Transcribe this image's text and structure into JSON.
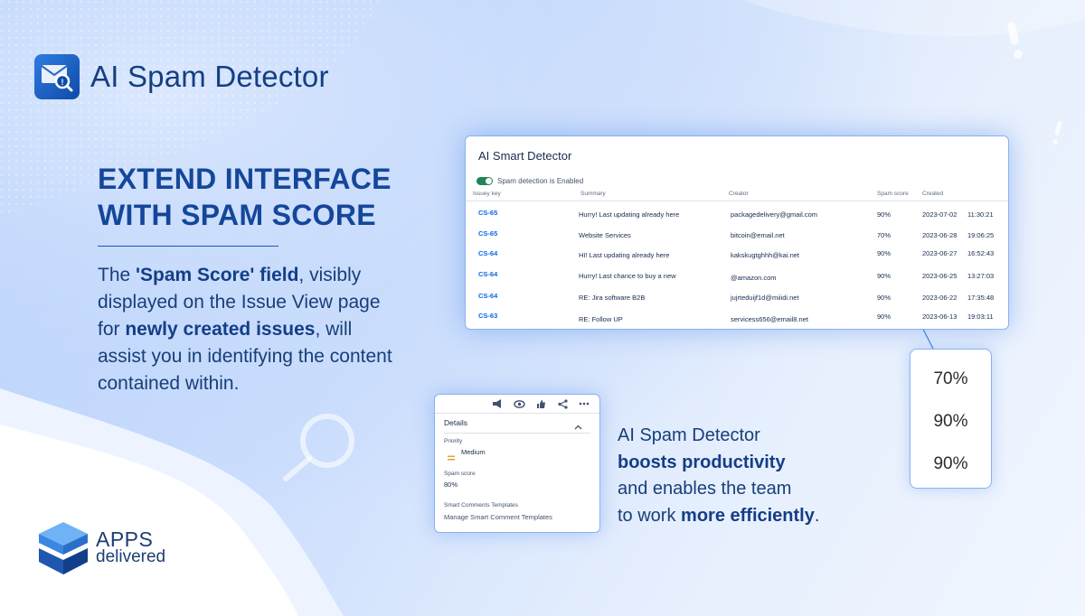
{
  "brand": {
    "title": "AI Spam Detector"
  },
  "hero": {
    "headline_1": "EXTEND INTERFACE",
    "headline_2": "WITH SPAM SCORE",
    "desc_1": "The ",
    "desc_2": "'Spam Score' field",
    "desc_3": ", visibly displayed on the Issue View page for ",
    "desc_4": "newly created issues",
    "desc_5": ", will assist you in identifying the content contained within."
  },
  "table": {
    "title": "AI Smart Detector",
    "toggle_label": "Spam detection is Enabled",
    "columns": [
      "Issuey key",
      "Summary",
      "Creator",
      "Spam score",
      "Created"
    ],
    "rows": [
      {
        "key": "CS-65",
        "summary": "Hurry! Last updating already here",
        "creator": "packagedelivery@gmail.com",
        "score": "90%",
        "date": "2023-07-02",
        "time": "11:30:21"
      },
      {
        "key": "CS-65",
        "summary": "Website Services",
        "creator": "bitcoin@email.net",
        "score": "70%",
        "date": "2023-06-28",
        "time": "19:06:25"
      },
      {
        "key": "CS-64",
        "summary": "HI! Last updating already here",
        "creator": "kakskugtghhh@kai.net",
        "score": "90%",
        "date": "2023-06-27",
        "time": "16:52:43"
      },
      {
        "key": "CS-64",
        "summary": "Hurry! Last chance to buy a new",
        "creator": "@amazon.com",
        "score": "90%",
        "date": "2023-06-25",
        "time": "13:27:03"
      },
      {
        "key": "CS-64",
        "summary": "RE: Jira software B2B",
        "creator": "jujrteduijf1d@miiidi.net",
        "score": "90%",
        "date": "2023-06-22",
        "time": "17:35:48"
      },
      {
        "key": "CS-63",
        "summary": "RE: Follow UP",
        "creator": "servicess656@email8.net",
        "score": "90%",
        "date": "2023-06-13",
        "time": "19:03:11"
      }
    ]
  },
  "score_popup": {
    "values": [
      "70%",
      "90%",
      "90%"
    ]
  },
  "details": {
    "header": "Details",
    "priority_label": "Priority",
    "priority_value": "Medium",
    "priority_icon": "equals-icon",
    "spam_label": "Spam score",
    "spam_value": "80%",
    "templates_label": "Smart Comments Templates",
    "templates_link": "Manage Smart Comment Templates",
    "toolbar_icons": [
      "megaphone-icon",
      "eye-icon",
      "thumbs-up-icon",
      "share-icon",
      "more-icon"
    ]
  },
  "promo": {
    "line_1": "AI Spam Detector",
    "line_2": "boosts productivity",
    "line_3": "and enables the team",
    "line_4a": "to work ",
    "line_4b": "more efficiently",
    "line_4c": "."
  },
  "footer_logo": {
    "word_1": "APPS",
    "word_2": "delivered"
  },
  "colors": {
    "brand_blue": "#14479a",
    "accent_blue": "#0c66e4",
    "toggle_green": "#1f845a",
    "priority_orange": "#e2a03f"
  }
}
